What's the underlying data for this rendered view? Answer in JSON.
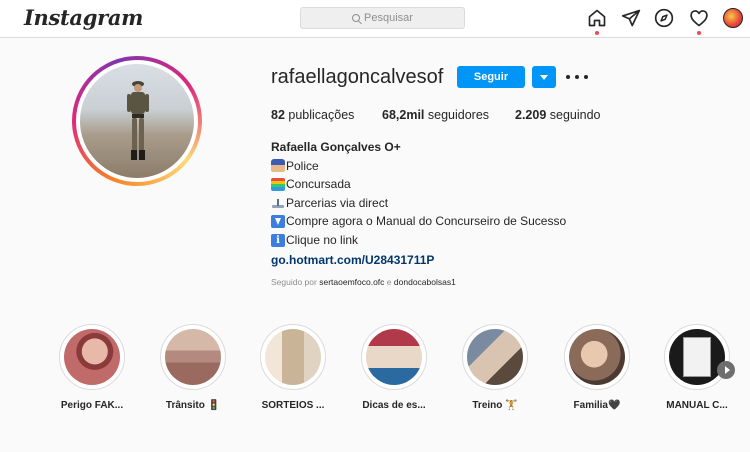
{
  "nav": {
    "logo": "Instagram",
    "search_placeholder": "Pesquisar",
    "icons": [
      "home-icon",
      "direct-icon",
      "explore-icon",
      "activity-icon",
      "profile-avatar"
    ]
  },
  "profile": {
    "username": "rafaellagoncalvesof",
    "follow_label": "Seguir",
    "stats": {
      "posts_count": "82",
      "posts_label": "publicações",
      "followers_count": "68,2mil",
      "followers_label": "seguidores",
      "following_count": "2.209",
      "following_label": "seguindo"
    },
    "bio": {
      "name": "Rafaella Gonçalves O+",
      "lines": [
        {
          "emoji": "police-officer-emoji",
          "text": "Police"
        },
        {
          "emoji": "books-emoji",
          "text": "Concursada"
        },
        {
          "emoji": "balance-emoji",
          "text": "Parcerias via direct"
        },
        {
          "emoji": "down-arrow-emoji",
          "text": "Compre agora o Manual do Concurseiro de Sucesso"
        },
        {
          "emoji": "info-emoji",
          "text": "Clique no link"
        }
      ],
      "link": "go.hotmart.com/U28431711P"
    },
    "followed_by": {
      "prefix": "Seguido por",
      "user1": "sertaoemfoco.ofc",
      "conj": "e",
      "user2": "dondocabolsas1"
    }
  },
  "highlights": [
    {
      "label": "Perigo FAK..."
    },
    {
      "label": "Trânsito 🚦"
    },
    {
      "label": "SORTEIOS ..."
    },
    {
      "label": "Dicas de es..."
    },
    {
      "label": "Treino 🏋"
    },
    {
      "label": "Familia🖤"
    },
    {
      "label": "MANUAL C..."
    }
  ],
  "colors": {
    "accent": "#0095f6",
    "link": "#00376b",
    "notification": "#ed4956"
  }
}
